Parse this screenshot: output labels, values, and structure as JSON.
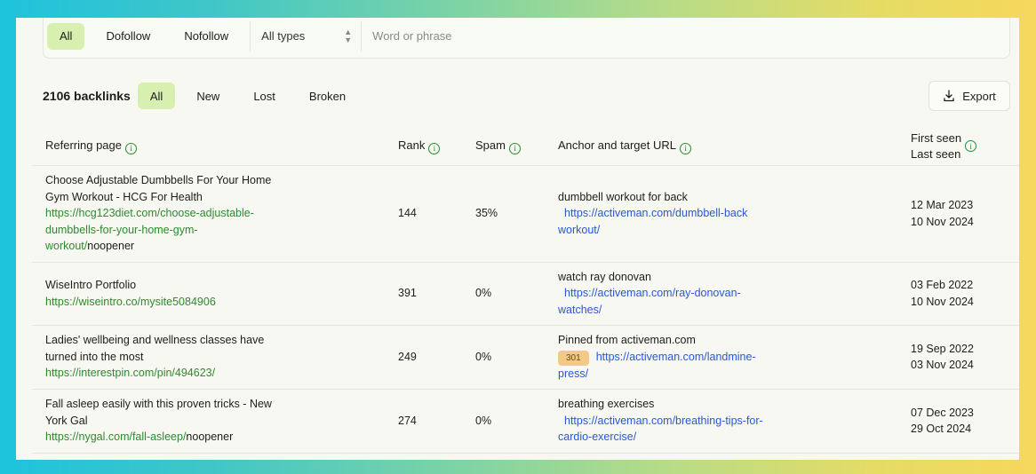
{
  "filters": {
    "link_types": [
      "All",
      "Dofollow",
      "Nofollow"
    ],
    "types_select": "All types",
    "search_placeholder": "Word or phrase"
  },
  "toolbar": {
    "count": "2106 backlinks",
    "tabs": [
      "All",
      "New",
      "Lost",
      "Broken"
    ],
    "export_label": "Export"
  },
  "table": {
    "headers": {
      "referring_page": "Referring page",
      "rank": "Rank",
      "spam": "Spam",
      "anchor": "Anchor and target URL",
      "first_seen": "First seen",
      "last_seen": "Last seen"
    },
    "rows": [
      {
        "title_l1": "Choose Adjustable Dumbbells For Your Home",
        "title_l2": "Gym Workout - HCG For Health",
        "url_l1": "https://hcg123diet.com/choose-adjustable-",
        "url_l2": "dumbbells-for-your-home-gym-",
        "url_l3": "workout/",
        "rel": "noopener",
        "rank": "144",
        "spam": "35%",
        "anchor": "dumbbell workout for back",
        "badge": "",
        "target_l1": "https://activeman.com/dumbbell-back",
        "target_l2": "workout/",
        "first_seen": "12 Mar 2023",
        "last_seen": "10 Nov 2024"
      },
      {
        "title_l1": "WiseIntro Portfolio",
        "url_l1": "https://wiseintro.co/mysite5084906",
        "rank": "391",
        "spam": "0%",
        "anchor": "watch ray donovan",
        "target_l1": "https://activeman.com/ray-donovan-",
        "target_l2": "watches/",
        "first_seen": "03 Feb 2022",
        "last_seen": "10 Nov 2024"
      },
      {
        "title_l1": "Ladies' wellbeing and wellness classes have",
        "title_l2": "turned into the most",
        "url_l1": "https://interestpin.com/pin/494623/",
        "rank": "249",
        "spam": "0%",
        "anchor": "Pinned from activeman.com",
        "badge": "301",
        "target_l1": "https://activeman.com/landmine-",
        "target_l2": "press/",
        "first_seen": "19 Sep 2022",
        "last_seen": "03 Nov 2024"
      },
      {
        "title_l1": "Fall asleep easily with this proven tricks - New",
        "title_l2": "York Gal",
        "url_l1": "https://nygal.com/fall-asleep/",
        "rel": "noopener",
        "rank": "274",
        "spam": "0%",
        "anchor": "breathing exercises",
        "target_l1": "https://activeman.com/breathing-tips-for-",
        "target_l2": "cardio-exercise/",
        "first_seen": "07 Dec 2023",
        "last_seen": "29 Oct 2024"
      }
    ]
  }
}
